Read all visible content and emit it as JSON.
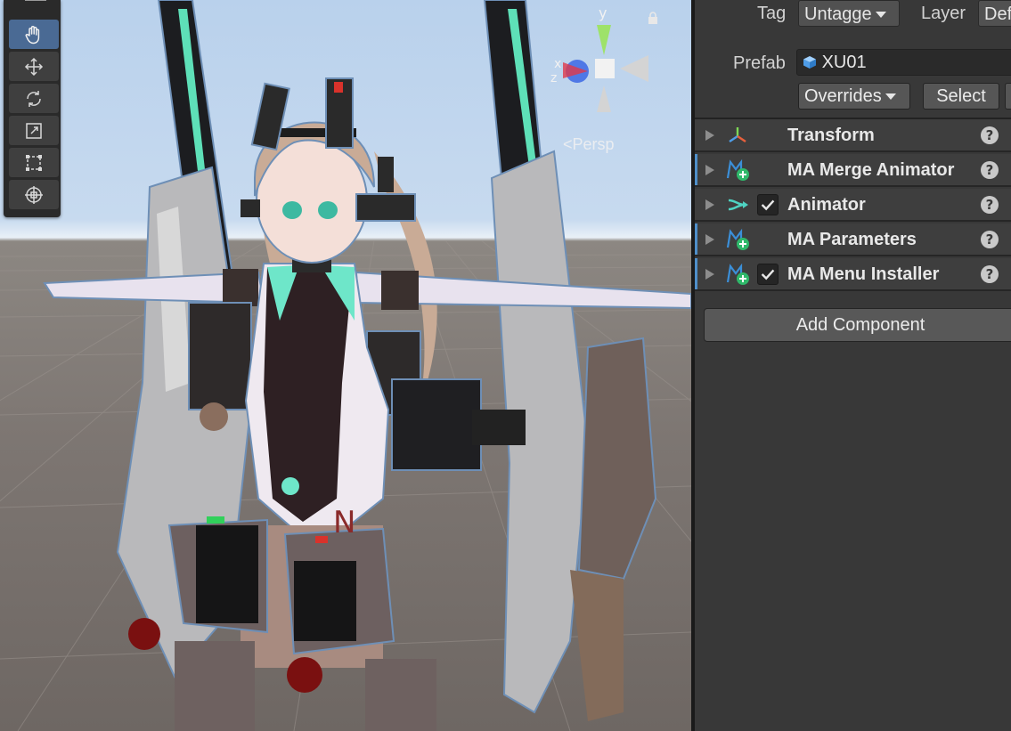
{
  "scene": {
    "projection_label": "Persp",
    "gizmo_axes": {
      "y": "y",
      "x": "x",
      "z": "z"
    },
    "tools": [
      {
        "name": "hand-tool",
        "icon": "hand-icon",
        "active": true
      },
      {
        "name": "move-tool",
        "icon": "move-icon",
        "active": false
      },
      {
        "name": "rotate-tool",
        "icon": "rotate-icon",
        "active": false
      },
      {
        "name": "scale-tool",
        "icon": "scale-icon",
        "active": false
      },
      {
        "name": "rect-tool",
        "icon": "rect-icon",
        "active": false
      },
      {
        "name": "transform-tool",
        "icon": "transform-icon",
        "active": false
      }
    ],
    "model_marking": "N"
  },
  "inspector": {
    "tag_label": "Tag",
    "tag_value": "Untagge",
    "layer_label": "Layer",
    "layer_value": "Def",
    "prefab_label": "Prefab",
    "prefab_value": "XU01",
    "overrides_label": "Overrides",
    "select_label": "Select",
    "components": [
      {
        "name": "Transform",
        "icon": "transform-axes-icon",
        "has_checkbox": false,
        "checked": false,
        "accent_bar": false
      },
      {
        "name": "MA Merge Animator",
        "icon": "modular-avatar-icon",
        "has_checkbox": false,
        "checked": false,
        "accent_bar": true
      },
      {
        "name": "Animator",
        "icon": "animator-icon",
        "has_checkbox": true,
        "checked": true,
        "accent_bar": false
      },
      {
        "name": "MA Parameters",
        "icon": "modular-avatar-icon",
        "has_checkbox": false,
        "checked": false,
        "accent_bar": true
      },
      {
        "name": "MA Menu Installer",
        "icon": "modular-avatar-icon",
        "has_checkbox": true,
        "checked": true,
        "accent_bar": true
      }
    ],
    "add_component_label": "Add Component"
  },
  "colors": {
    "active_tool": "#4a6a94",
    "accent_bar": "#4f8fca",
    "inspector_bg": "#383838"
  }
}
